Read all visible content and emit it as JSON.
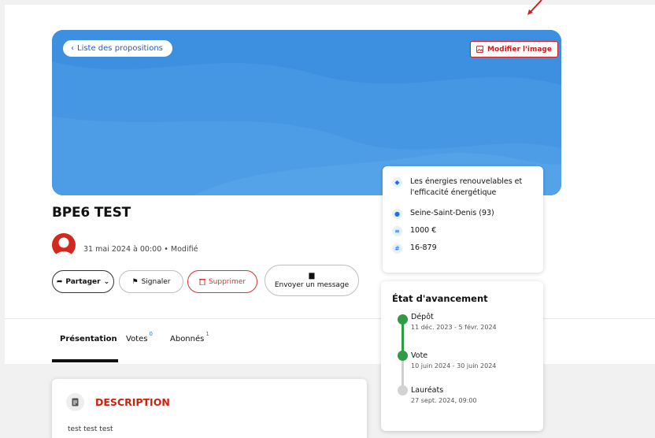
{
  "header": {
    "back_label": "Liste des propositions",
    "edit_image_label": "Modifier l'image"
  },
  "proposal": {
    "title": "BPE6 TEST",
    "meta": "31 mai 2024 à 00:00 • Modifié"
  },
  "actions": {
    "share_label": "Partager",
    "report_label": "Signaler",
    "delete_label": "Supprimer",
    "message_label": "Envoyer un message"
  },
  "tabs": [
    {
      "label": "Présentation",
      "count": ""
    },
    {
      "label": "Votes",
      "count": "0"
    },
    {
      "label": "Abonnés",
      "count": "1"
    }
  ],
  "info": {
    "theme": "Les énergies renouvelables et l'efficacité énergétique",
    "location": "Seine-Saint-Denis (93)",
    "amount": "1000 €",
    "reference": "16-879"
  },
  "progress": {
    "title": "État d'avancement",
    "steps": [
      {
        "name": "Dépôt",
        "dates": "11 déc. 2023 - 5 févr. 2024",
        "status": "done"
      },
      {
        "name": "Vote",
        "dates": "10 juin 2024 - 30 juin 2024",
        "status": "done"
      },
      {
        "name": "Lauréats",
        "dates": "27 sept. 2024, 09:00",
        "status": "upcoming"
      }
    ]
  },
  "description": {
    "title": "DESCRIPTION",
    "text": "test test test"
  },
  "icons": {
    "back": "chevron-left-icon",
    "edit_image": "image-icon",
    "share": "share-icon",
    "report": "flag-icon",
    "delete": "trash-icon",
    "message": "chat-icon",
    "theme": "tag-icon",
    "location": "pin-icon",
    "amount": "coins-icon",
    "reference": "hash-icon",
    "description": "document-icon"
  },
  "colors": {
    "hero_blue": "#3d8fe0",
    "accent_red": "#c81e1e",
    "link_blue": "#1a73e8",
    "step_done": "#2f9c44",
    "step_upcoming": "#cfcfcf"
  }
}
